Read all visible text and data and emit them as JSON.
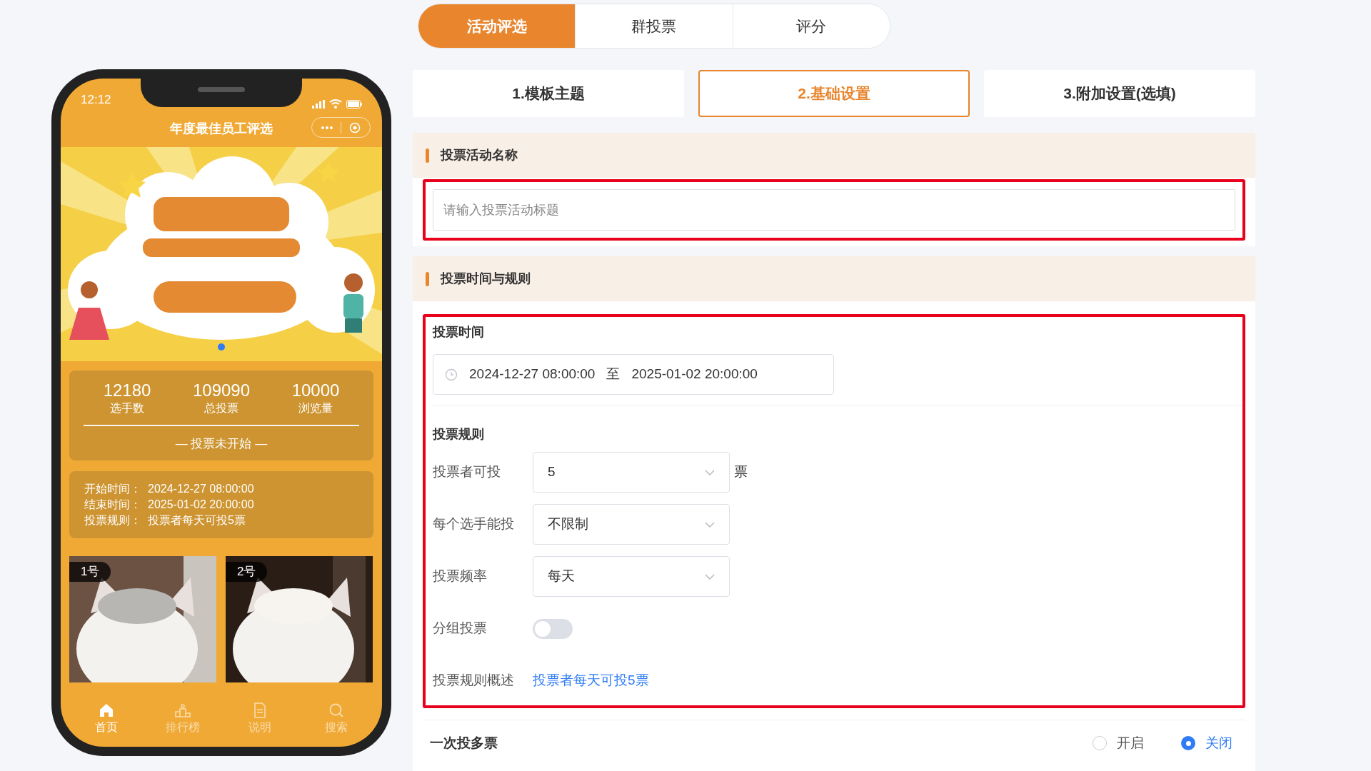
{
  "phone": {
    "status_time": "12:12",
    "title": "年度最佳员工评选",
    "stats": [
      {
        "value": "12180",
        "label": "选手数"
      },
      {
        "value": "109090",
        "label": "总投票"
      },
      {
        "value": "10000",
        "label": "浏览量"
      }
    ],
    "vote_status": "— 投票未开始 —",
    "info": [
      {
        "label": "开始时间：",
        "value": "2024-12-27 08:00:00"
      },
      {
        "label": "结束时间：",
        "value": "2025-01-02 20:00:00"
      },
      {
        "label": "投票规则：",
        "value": "投票者每天可投5票"
      }
    ],
    "entries": [
      {
        "badge": "1号",
        "kind": "picture"
      },
      {
        "badge": "2号",
        "kind": "picture"
      }
    ],
    "tab_bar": [
      {
        "label": "首页",
        "selected": true
      },
      {
        "label": "排行榜",
        "selected": false
      },
      {
        "label": "说明",
        "selected": false
      },
      {
        "label": "搜索",
        "selected": false
      }
    ]
  },
  "mode_tabs": [
    {
      "label": "活动评选",
      "selected": true
    },
    {
      "label": "群投票",
      "selected": false
    },
    {
      "label": "评分",
      "selected": false
    }
  ],
  "steps": [
    {
      "label": "1.模板主题",
      "selected": false
    },
    {
      "label": "2.基础设置",
      "selected": true
    },
    {
      "label": "3.附加设置(选填)",
      "selected": false
    }
  ],
  "name_section": {
    "title": "投票活动名称",
    "input": {
      "placeholder": "请输入投票活动标题"
    }
  },
  "rules_section": {
    "title": "投票时间与规则",
    "time_label": "投票时间",
    "time_start": "2024-12-27 08:00:00",
    "time_separator": "至",
    "time_end": "2025-01-02 20:00:00",
    "rules_label": "投票规则",
    "rows": [
      {
        "kind": "select",
        "label": "投票者可投",
        "value": "5",
        "suffix": "票"
      },
      {
        "kind": "select",
        "label": "每个选手能投",
        "value": "不限制"
      },
      {
        "kind": "select",
        "label": "投票频率",
        "value": "每天"
      },
      {
        "kind": "toggle",
        "label": "分组投票",
        "on": false
      },
      {
        "kind": "summary",
        "label": "投票规则概述",
        "value": "投票者每天可投5票"
      }
    ]
  },
  "multi_vote": {
    "label": "一次投多票",
    "options": [
      {
        "label": "开启",
        "selected": false
      },
      {
        "label": "关闭",
        "selected": true
      }
    ]
  }
}
